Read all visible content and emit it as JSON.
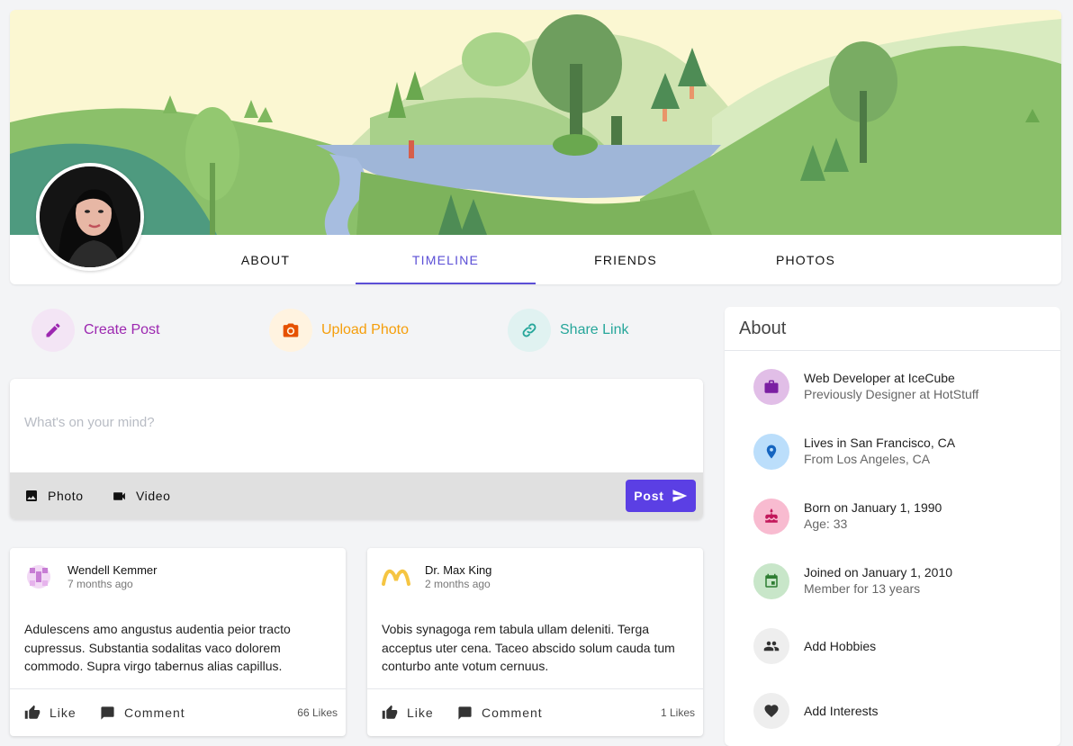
{
  "profile": {
    "tabs": [
      {
        "label": "ABOUT"
      },
      {
        "label": "TIMELINE"
      },
      {
        "label": "FRIENDS"
      },
      {
        "label": "PHOTOS"
      }
    ],
    "active_tab": "TIMELINE"
  },
  "actions": {
    "create_post": {
      "label": "Create Post",
      "icon": "pencil-icon",
      "color": "#9c27b0",
      "bg": "#f3e5f5"
    },
    "upload_photo": {
      "label": "Upload Photo",
      "icon": "camera-icon",
      "color": "#f59e0b",
      "bg": "#fff3e0"
    },
    "share_link": {
      "label": "Share Link",
      "icon": "link-icon",
      "color": "#26a69a",
      "bg": "#e0f2f1"
    }
  },
  "composer": {
    "placeholder": "What's on your mind?",
    "photo_label": "Photo",
    "video_label": "Video",
    "post_label": "Post",
    "accent": "#5b3fe4"
  },
  "posts": [
    {
      "author": "Wendell Kemmer",
      "time": "7 months ago",
      "body": "Adulescens amo angustus audentia peior tracto cupressus. Substantia sodalitas vaco dolorem commodo. Supra virgo tabernus alias capillus.",
      "like_label": "Like",
      "comment_label": "Comment",
      "likes": "66 Likes"
    },
    {
      "author": "Dr. Max King",
      "time": "2 months ago",
      "body": "Vobis synagoga rem tabula ullam deleniti. Terga acceptus uter cena. Taceo abscido solum cauda tum conturbo ante votum cernuus.",
      "like_label": "Like",
      "comment_label": "Comment",
      "likes": "1 Likes"
    }
  ],
  "about": {
    "title": "About",
    "items": [
      {
        "icon": "briefcase-icon",
        "line1": "Web Developer at IceCube",
        "line2": "Previously Designer at HotStuff",
        "bg": "#e1bee7",
        "color": "#7b1fa2"
      },
      {
        "icon": "location-pin-icon",
        "line1": "Lives in San Francisco, CA",
        "line2": "From Los Angeles, CA",
        "bg": "#bbdefb",
        "color": "#1565c0"
      },
      {
        "icon": "cake-icon",
        "line1": "Born on January 1, 1990",
        "line2": "Age: 33",
        "bg": "#f8bbd0",
        "color": "#c2185b"
      },
      {
        "icon": "calendar-icon",
        "line1": "Joined on January 1, 2010",
        "line2": "Member for 13 years",
        "bg": "#c8e6c9",
        "color": "#2e7d32"
      },
      {
        "icon": "people-icon",
        "line1": "Add Hobbies",
        "bg": "#eeeeee",
        "color": "#333333"
      },
      {
        "icon": "heart-icon",
        "line1": "Add Interests",
        "bg": "#eeeeee",
        "color": "#333333"
      }
    ]
  }
}
